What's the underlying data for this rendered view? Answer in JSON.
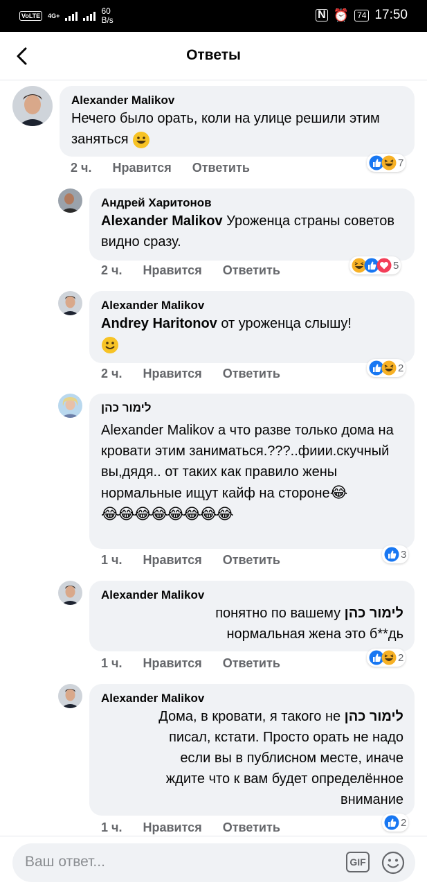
{
  "status_bar": {
    "volte": "VoLTE",
    "network": "4G+",
    "speed_value": "60",
    "speed_unit": "B/s",
    "battery": "74",
    "time": "17:50"
  },
  "header": {
    "title": "Ответы"
  },
  "comments": [
    {
      "author": "Alexander Malikov",
      "text": "Нечего было орать, коли на улице решили этим заняться",
      "time": "2 ч.",
      "like": "Нравится",
      "reply": "Ответить",
      "reactions": [
        "like",
        "haha"
      ],
      "reaction_count": "7"
    },
    {
      "author": "Андрей Харитонов",
      "mention": "Alexander Malikov",
      "text": " Уроженца страны советов видно сразу.",
      "time": "2 ч.",
      "like": "Нравится",
      "reply": "Ответить",
      "reactions": [
        "haha",
        "like",
        "love"
      ],
      "reaction_count": "5"
    },
    {
      "author": "Alexander Malikov",
      "mention": "Andrey  Haritonov",
      "text": " от уроженца слышу!",
      "time": "2 ч.",
      "like": "Нравится",
      "reply": "Ответить",
      "reactions": [
        "like",
        "haha"
      ],
      "reaction_count": "2"
    },
    {
      "author": "לימור כהן",
      "text": "Alexander Malikov а что разве только дома на кровати этим заниматься.???..фиии.скучный вы,дядя.. от таких как правило жены нормальные ищут кайф на  стороне",
      "time": "1 ч.",
      "like": "Нравится",
      "reply": "Ответить",
      "reactions": [
        "like"
      ],
      "reaction_count": "3"
    },
    {
      "author": "Alexander Malikov",
      "text_a": "понятно по вашему ",
      "mention": "לימור כהן",
      "text_b": "нормальная жена это б**дь",
      "time": "1 ч.",
      "like": "Нравится",
      "reply": "Ответить",
      "reactions": [
        "like",
        "haha"
      ],
      "reaction_count": "2"
    },
    {
      "author": "Alexander Malikov",
      "text_a": "Дома, в кровати, я такого не ",
      "mention": "לימור כהן",
      "text_b": "писал, кстати. Просто орать не надо",
      "text_c": "если вы в публисном месте, иначе",
      "text_d": "ждите что к вам будет определённое",
      "text_e": "внимание",
      "time": "1 ч.",
      "like": "Нравится",
      "reply": "Ответить",
      "reactions": [
        "like"
      ],
      "reaction_count": "2"
    }
  ],
  "composer": {
    "placeholder": "Ваш ответ...",
    "gif_label": "GIF"
  },
  "colors": {
    "like_blue": "#1877f2",
    "love_red": "#f33e58",
    "haha_yellow": "#f7b125",
    "bubble": "#f0f2f5",
    "meta_gray": "#65676b"
  },
  "icons": [
    "back-arrow-icon",
    "gif-icon",
    "smiley-icon",
    "like-reaction-icon",
    "haha-reaction-icon",
    "love-reaction-icon",
    "grinning-emoji",
    "smiling-emoji",
    "tears-of-joy-emoji"
  ]
}
